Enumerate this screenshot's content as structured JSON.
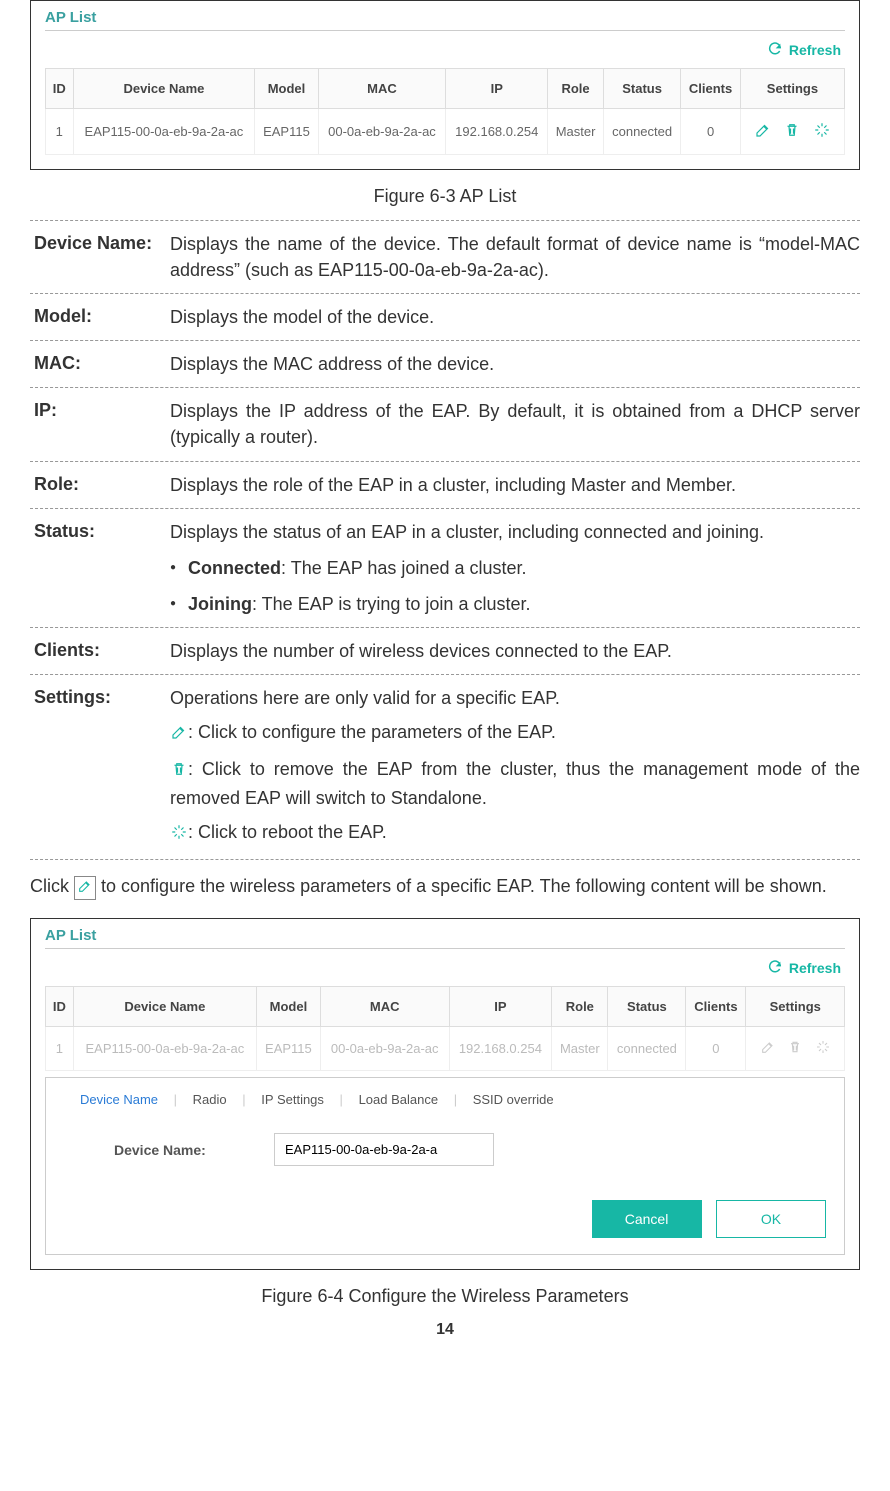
{
  "figure1": {
    "panel_title": "AP List",
    "refresh": "Refresh",
    "headers": [
      "ID",
      "Device Name",
      "Model",
      "MAC",
      "IP",
      "Role",
      "Status",
      "Clients",
      "Settings"
    ],
    "row": {
      "id": "1",
      "device_name": "EAP115-00-0a-eb-9a-2a-ac",
      "model": "EAP115",
      "mac": "00-0a-eb-9a-2a-ac",
      "ip": "192.168.0.254",
      "role": "Master",
      "status": "connected",
      "clients": "0"
    },
    "caption": "Figure 6-3 AP List"
  },
  "definitions": {
    "device_name": {
      "term": "Device Name:",
      "desc": "Displays the name of the device. The default format of device name is “model-MAC address” (such as EAP115-00-0a-eb-9a-2a-ac)."
    },
    "model": {
      "term": "Model:",
      "desc": "Displays the model of the device."
    },
    "mac": {
      "term": "MAC:",
      "desc": "Displays the MAC address of the device."
    },
    "ip": {
      "term": "IP:",
      "desc": "Displays the IP address of the EAP. By default, it is obtained from a DHCP server (typically a router)."
    },
    "role": {
      "term": "Role:",
      "desc": "Displays the role of the EAP in a cluster, including Master and Member."
    },
    "status": {
      "term": "Status:",
      "desc": "Displays the status of an EAP in a cluster, including connected and joining.",
      "b1_label": "Connected",
      "b1_text": ": The EAP has joined a cluster.",
      "b2_label": "Joining",
      "b2_text": ": The EAP is trying to join a cluster."
    },
    "clients": {
      "term": "Clients:",
      "desc": "Displays the number of wireless devices connected to the EAP."
    },
    "settings": {
      "term": "Settings:",
      "desc": "Operations here are only valid for a specific EAP.",
      "l1": ": Click to configure the parameters of the EAP.",
      "l2": ": Click to remove the EAP from the cluster, thus the management mode of the removed EAP will switch to Standalone.",
      "l3": ": Click to reboot the EAP."
    }
  },
  "para": {
    "t1": "Click ",
    "t2": " to configure the wireless parameters of a specific EAP. The following content will be shown."
  },
  "figure2": {
    "panel_title": "AP List",
    "refresh": "Refresh",
    "headers": [
      "ID",
      "Device Name",
      "Model",
      "MAC",
      "IP",
      "Role",
      "Status",
      "Clients",
      "Settings"
    ],
    "row": {
      "id": "1",
      "device_name": "EAP115-00-0a-eb-9a-2a-ac",
      "model": "EAP115",
      "mac": "00-0a-eb-9a-2a-ac",
      "ip": "192.168.0.254",
      "role": "Master",
      "status": "connected",
      "clients": "0"
    },
    "tabs": {
      "t1": "Device Name",
      "t2": "Radio",
      "t3": "IP Settings",
      "t4": "Load Balance",
      "t5": "SSID override"
    },
    "form": {
      "label": "Device Name:",
      "value": "EAP115-00-0a-eb-9a-2a-a"
    },
    "cancel": "Cancel",
    "ok": "OK",
    "caption": "Figure 6-4 Configure the Wireless Parameters"
  },
  "page_number": "14"
}
